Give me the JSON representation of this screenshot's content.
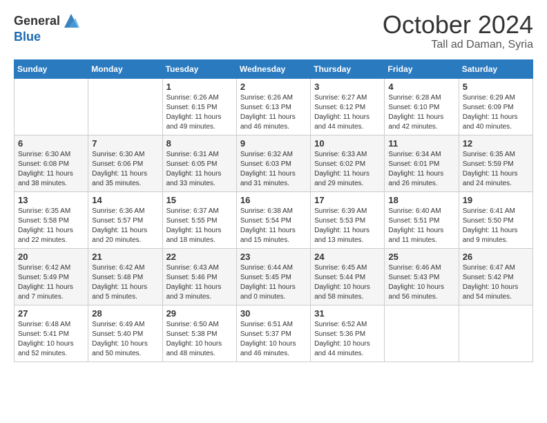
{
  "header": {
    "logo": {
      "general": "General",
      "blue": "Blue"
    },
    "title": "October 2024",
    "location": "Tall ad Daman, Syria"
  },
  "weekdays": [
    "Sunday",
    "Monday",
    "Tuesday",
    "Wednesday",
    "Thursday",
    "Friday",
    "Saturday"
  ],
  "weeks": [
    [
      {
        "day": null,
        "info": null
      },
      {
        "day": null,
        "info": null
      },
      {
        "day": "1",
        "sunrise": "6:26 AM",
        "sunset": "6:15 PM",
        "daylight": "11 hours and 49 minutes."
      },
      {
        "day": "2",
        "sunrise": "6:26 AM",
        "sunset": "6:13 PM",
        "daylight": "11 hours and 46 minutes."
      },
      {
        "day": "3",
        "sunrise": "6:27 AM",
        "sunset": "6:12 PM",
        "daylight": "11 hours and 44 minutes."
      },
      {
        "day": "4",
        "sunrise": "6:28 AM",
        "sunset": "6:10 PM",
        "daylight": "11 hours and 42 minutes."
      },
      {
        "day": "5",
        "sunrise": "6:29 AM",
        "sunset": "6:09 PM",
        "daylight": "11 hours and 40 minutes."
      }
    ],
    [
      {
        "day": "6",
        "sunrise": "6:30 AM",
        "sunset": "6:08 PM",
        "daylight": "11 hours and 38 minutes."
      },
      {
        "day": "7",
        "sunrise": "6:30 AM",
        "sunset": "6:06 PM",
        "daylight": "11 hours and 35 minutes."
      },
      {
        "day": "8",
        "sunrise": "6:31 AM",
        "sunset": "6:05 PM",
        "daylight": "11 hours and 33 minutes."
      },
      {
        "day": "9",
        "sunrise": "6:32 AM",
        "sunset": "6:03 PM",
        "daylight": "11 hours and 31 minutes."
      },
      {
        "day": "10",
        "sunrise": "6:33 AM",
        "sunset": "6:02 PM",
        "daylight": "11 hours and 29 minutes."
      },
      {
        "day": "11",
        "sunrise": "6:34 AM",
        "sunset": "6:01 PM",
        "daylight": "11 hours and 26 minutes."
      },
      {
        "day": "12",
        "sunrise": "6:35 AM",
        "sunset": "5:59 PM",
        "daylight": "11 hours and 24 minutes."
      }
    ],
    [
      {
        "day": "13",
        "sunrise": "6:35 AM",
        "sunset": "5:58 PM",
        "daylight": "11 hours and 22 minutes."
      },
      {
        "day": "14",
        "sunrise": "6:36 AM",
        "sunset": "5:57 PM",
        "daylight": "11 hours and 20 minutes."
      },
      {
        "day": "15",
        "sunrise": "6:37 AM",
        "sunset": "5:55 PM",
        "daylight": "11 hours and 18 minutes."
      },
      {
        "day": "16",
        "sunrise": "6:38 AM",
        "sunset": "5:54 PM",
        "daylight": "11 hours and 15 minutes."
      },
      {
        "day": "17",
        "sunrise": "6:39 AM",
        "sunset": "5:53 PM",
        "daylight": "11 hours and 13 minutes."
      },
      {
        "day": "18",
        "sunrise": "6:40 AM",
        "sunset": "5:51 PM",
        "daylight": "11 hours and 11 minutes."
      },
      {
        "day": "19",
        "sunrise": "6:41 AM",
        "sunset": "5:50 PM",
        "daylight": "11 hours and 9 minutes."
      }
    ],
    [
      {
        "day": "20",
        "sunrise": "6:42 AM",
        "sunset": "5:49 PM",
        "daylight": "11 hours and 7 minutes."
      },
      {
        "day": "21",
        "sunrise": "6:42 AM",
        "sunset": "5:48 PM",
        "daylight": "11 hours and 5 minutes."
      },
      {
        "day": "22",
        "sunrise": "6:43 AM",
        "sunset": "5:46 PM",
        "daylight": "11 hours and 3 minutes."
      },
      {
        "day": "23",
        "sunrise": "6:44 AM",
        "sunset": "5:45 PM",
        "daylight": "11 hours and 0 minutes."
      },
      {
        "day": "24",
        "sunrise": "6:45 AM",
        "sunset": "5:44 PM",
        "daylight": "10 hours and 58 minutes."
      },
      {
        "day": "25",
        "sunrise": "6:46 AM",
        "sunset": "5:43 PM",
        "daylight": "10 hours and 56 minutes."
      },
      {
        "day": "26",
        "sunrise": "6:47 AM",
        "sunset": "5:42 PM",
        "daylight": "10 hours and 54 minutes."
      }
    ],
    [
      {
        "day": "27",
        "sunrise": "6:48 AM",
        "sunset": "5:41 PM",
        "daylight": "10 hours and 52 minutes."
      },
      {
        "day": "28",
        "sunrise": "6:49 AM",
        "sunset": "5:40 PM",
        "daylight": "10 hours and 50 minutes."
      },
      {
        "day": "29",
        "sunrise": "6:50 AM",
        "sunset": "5:38 PM",
        "daylight": "10 hours and 48 minutes."
      },
      {
        "day": "30",
        "sunrise": "6:51 AM",
        "sunset": "5:37 PM",
        "daylight": "10 hours and 46 minutes."
      },
      {
        "day": "31",
        "sunrise": "6:52 AM",
        "sunset": "5:36 PM",
        "daylight": "10 hours and 44 minutes."
      },
      {
        "day": null,
        "info": null
      },
      {
        "day": null,
        "info": null
      }
    ]
  ]
}
